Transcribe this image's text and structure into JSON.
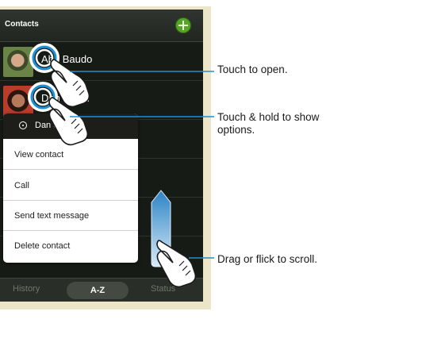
{
  "app": {
    "title": "Contacts",
    "add_icon": "plus-icon"
  },
  "contacts": [
    {
      "name": "Abe Baudo",
      "avatar_icon": "contact-photo"
    },
    {
      "name": "Dan Smith",
      "avatar_icon": "contact-photo"
    }
  ],
  "context_menu": {
    "title": "Dan Smith",
    "items": [
      "View contact",
      "Call",
      "Send text message",
      "Delete contact"
    ]
  },
  "tabs": [
    "History",
    "A-Z",
    "Status"
  ],
  "active_tab": "A-Z",
  "callouts": {
    "touch_open": "Touch to open.",
    "touch_hold": "Touch & hold to show\noptions.",
    "drag_scroll": "Drag or flick to scroll."
  },
  "colors": {
    "callout_line": "#1c8fd8",
    "accent_green": "#55a528",
    "background": "#171b16",
    "frame": "#ece6c9"
  }
}
